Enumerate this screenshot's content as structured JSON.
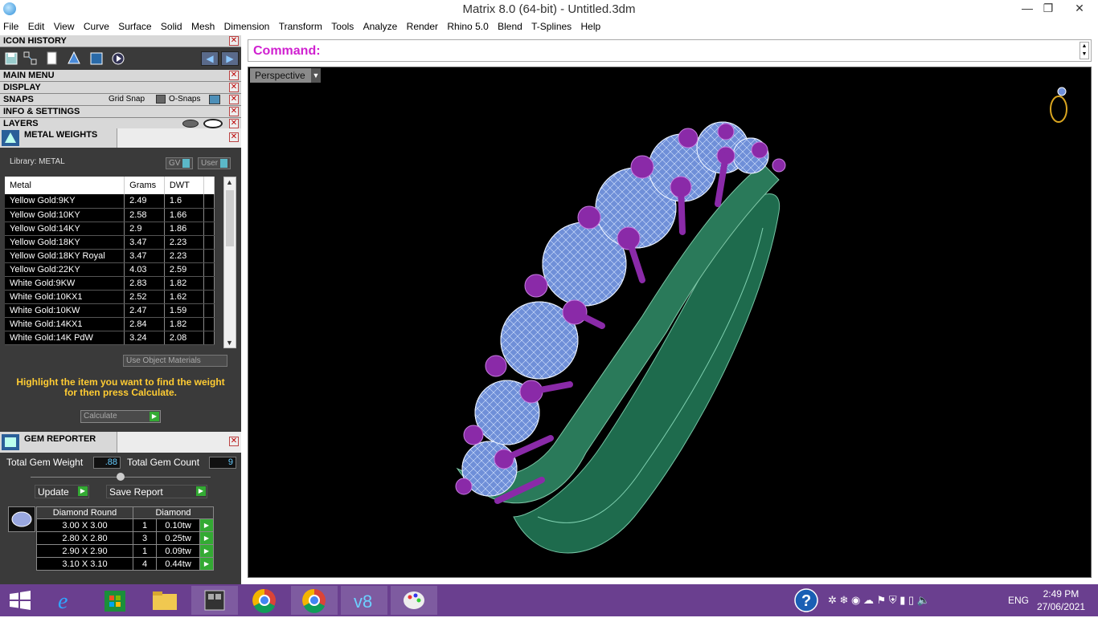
{
  "window": {
    "title": "Matrix 8.0 (64-bit) - Untitled.3dm",
    "minimize": "—",
    "restore": "❐",
    "close": "✕"
  },
  "menu": [
    "File",
    "Edit",
    "View",
    "Curve",
    "Surface",
    "Solid",
    "Mesh",
    "Dimension",
    "Transform",
    "Tools",
    "Analyze",
    "Render",
    "Rhino 5.0",
    "Blend",
    "T-Splines",
    "Help"
  ],
  "panels": {
    "icon_history": "ICON HISTORY",
    "main_menu": "MAIN MENU",
    "display": "DISPLAY",
    "snaps": "SNAPS",
    "grid_snap": "Grid Snap",
    "o_snaps": "O-Snaps",
    "info_settings": "INFO & SETTINGS",
    "layers": "LAYERS",
    "close_glyph": "✕"
  },
  "metal_weights": {
    "title": "METAL WEIGHTS",
    "library": "Library: METAL",
    "gv_label": "GV",
    "user_label": "User",
    "columns": [
      "Metal",
      "Grams",
      "DWT"
    ],
    "rows": [
      [
        "Yellow Gold:9KY",
        "2.49",
        "1.6"
      ],
      [
        "Yellow Gold:10KY",
        "2.58",
        "1.66"
      ],
      [
        "Yellow Gold:14KY",
        "2.9",
        "1.86"
      ],
      [
        "Yellow Gold:18KY",
        "3.47",
        "2.23"
      ],
      [
        "Yellow Gold:18KY Royal",
        "3.47",
        "2.23"
      ],
      [
        "Yellow Gold:22KY",
        "4.03",
        "2.59"
      ],
      [
        "White Gold:9KW",
        "2.83",
        "1.82"
      ],
      [
        "White Gold:10KX1",
        "2.52",
        "1.62"
      ],
      [
        "White Gold:10KW",
        "2.47",
        "1.59"
      ],
      [
        "White Gold:14KX1",
        "2.84",
        "1.82"
      ],
      [
        "White Gold:14K PdW",
        "3.24",
        "2.08"
      ]
    ],
    "use_object_materials": "Use Object Materials",
    "hint": "Highlight the item you want to find the weight for then press Calculate.",
    "calculate": "Calculate"
  },
  "gem_reporter": {
    "title": "GEM REPORTER",
    "total_weight_label": "Total Gem Weight",
    "total_weight_value": ".88",
    "total_count_label": "Total Gem Count",
    "total_count_value": "9",
    "update": "Update",
    "save_report": "Save Report",
    "headers": [
      "Diamond Round",
      "Diamond"
    ],
    "rows": [
      [
        "3.00 X 3.00",
        "1",
        "0.10tw"
      ],
      [
        "2.80 X 2.80",
        "3",
        "0.25tw"
      ],
      [
        "2.90 X 2.90",
        "1",
        "0.09tw"
      ],
      [
        "3.10 X 3.10",
        "4",
        "0.44tw"
      ]
    ]
  },
  "command": {
    "label": "Command:"
  },
  "viewport": {
    "label": "Perspective"
  },
  "taskbar": {
    "language": "ENG",
    "time": "2:49 PM",
    "date": "27/06/2021"
  }
}
